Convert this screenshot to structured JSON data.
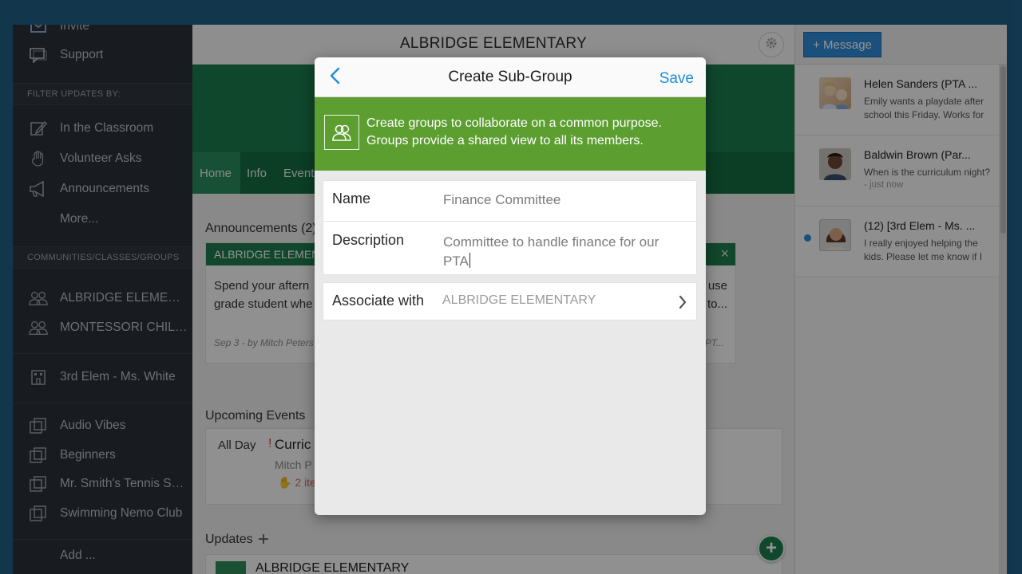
{
  "sidebar": {
    "top_items": [
      {
        "label": "Invite",
        "icon": "mail-icon"
      },
      {
        "label": "Support",
        "icon": "chat-icon"
      }
    ],
    "filter_heading": "FILTER UPDATES BY:",
    "filters": [
      {
        "label": "In the Classroom",
        "icon": "pencil-icon"
      },
      {
        "label": "Volunteer Asks",
        "icon": "hand-icon"
      },
      {
        "label": "Announcements",
        "icon": "megaphone-icon"
      },
      {
        "label": "More..."
      }
    ],
    "groups_heading": "COMMUNITIES/CLASSES/GROUPS",
    "communities": [
      {
        "label": "ALBRIDGE ELEMENTARY",
        "icon": "people-icon"
      },
      {
        "label": "MONTESSORI CHILDREN",
        "icon": "people-icon"
      }
    ],
    "classes": [
      {
        "label": "3rd Elem - Ms. White",
        "icon": "building-icon"
      }
    ],
    "groups": [
      {
        "label": "Audio Vibes",
        "icon": "subgroup-icon"
      },
      {
        "label": "Beginners",
        "icon": "subgroup-icon"
      },
      {
        "label": "Mr. Smith's Tennis School",
        "icon": "subgroup-icon"
      },
      {
        "label": "Swimming Nemo Club",
        "icon": "subgroup-icon"
      }
    ],
    "add_label": "Add ..."
  },
  "main": {
    "title": "ALBRIDGE ELEMENTARY",
    "tabs": [
      {
        "label": "Home",
        "active": true
      },
      {
        "label": "Info"
      },
      {
        "label": "Events"
      }
    ],
    "announcements_label": "Announcements (2)",
    "announcement": {
      "header": "ALBRIDGE ELEMENTARY",
      "body_line1": "Spend your aftern",
      "body_line2": "grade student whe",
      "right_line1": "use",
      "right_line2": "to...",
      "meta": "Sep 3 - by Mitch Peters",
      "meta_right": "PT..."
    },
    "upcoming_label": "Upcoming Events",
    "event": {
      "when": "All Day",
      "alert": "!",
      "title": "Curric",
      "author": "Mitch P",
      "items": "2 ite"
    },
    "updates_label": "Updates",
    "updates_first": "ALBRIDGE ELEMENTARY"
  },
  "right_panel": {
    "message_button": "+ Message",
    "conversations": [
      {
        "name": "Helen Sanders (PTA ...",
        "snippet": "Emily wants a playdate after school this Friday. Works for",
        "time": "",
        "unread": false
      },
      {
        "name": "Baldwin Brown (Par...",
        "snippet": "When is the curriculum night?",
        "time": "- just now",
        "unread": false
      },
      {
        "name": "(12) [3rd Elem - Ms. ...",
        "snippet": "I really enjoyed helping the kids. Please let me know if I",
        "time": "",
        "unread": true
      }
    ]
  },
  "modal": {
    "title": "Create Sub-Group",
    "save_label": "Save",
    "info_line1": "Create groups to collaborate on a common purpose.",
    "info_line2": "Groups provide a shared view to all its members.",
    "name_label": "Name",
    "name_value": "Finance Committee",
    "description_label": "Description",
    "description_line1": "Committee to handle finance for our",
    "description_line2": "PTA",
    "associate_label": "Associate with",
    "associate_value": "ALBRIDGE ELEMENTARY"
  },
  "colors": {
    "green_dark": "#1b7a4c",
    "green_modal": "#5d9e31",
    "accent_blue": "#1d8ed6",
    "sidebar_bg": "#2a2f36"
  }
}
